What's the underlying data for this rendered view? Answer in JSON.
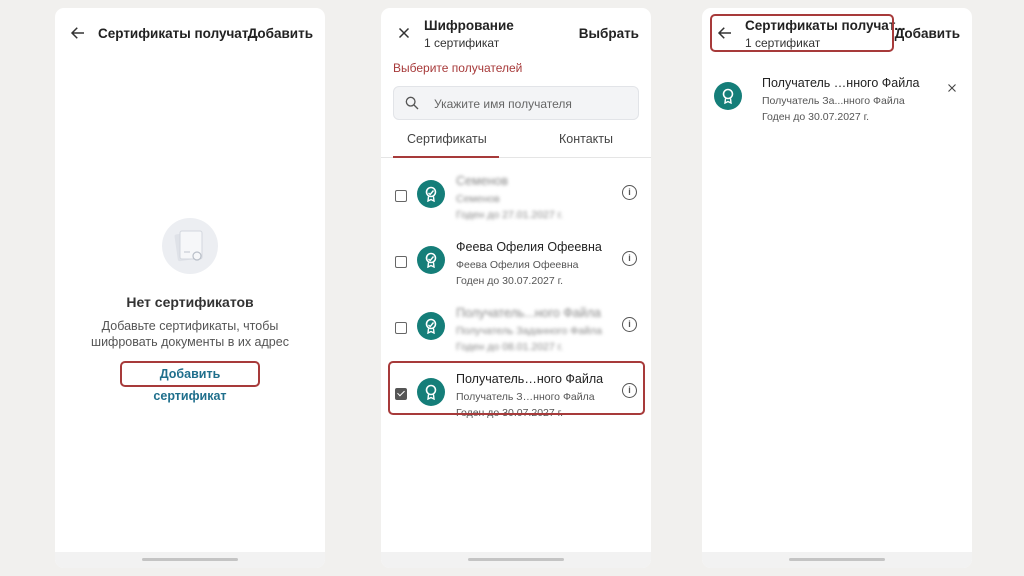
{
  "panel1": {
    "title": "Сертификаты получат...",
    "action": "Добавить",
    "empty_title": "Нет сертификатов",
    "empty_desc": "Добавьте сертификаты, чтобы шифровать документы в их адрес",
    "add_link": "Добавить сертификат"
  },
  "panel2": {
    "title": "Шифрование",
    "subtitle": "1 сертификат",
    "action": "Выбрать",
    "warning": "Выберите получателей",
    "search_placeholder": "Укажите имя получателя",
    "tabs": [
      "Сертификаты",
      "Контакты"
    ],
    "rows": [
      {
        "name": "Семенов",
        "line2": "Семенов",
        "line3": "Годен до 27.01.2027 г.",
        "checked": false
      },
      {
        "name": "Феева Офелия Офеевна",
        "line2": "Феева Офелия Офеевна",
        "line3": "Годен до 30.07.2027 г.",
        "checked": false
      },
      {
        "name": "Получатель...ного Файла",
        "line2": "Получатель Заданного Файла",
        "line3": "Годен до 08.01.2027 г.",
        "checked": false
      },
      {
        "name": "Получатель…ного Файла",
        "line2": "Получатель З…нного Файла",
        "line3": "Годен до 30.07.2027 г.",
        "checked": true
      }
    ]
  },
  "panel3": {
    "title": "Сертификаты получат...",
    "subtitle": "1 сертификат",
    "action": "Добавить",
    "item": {
      "name": "Получатель …нного Файла",
      "line2": "Получатель За...нного Файла",
      "line3": "Годен до 30.07.2027 г."
    }
  },
  "colors": {
    "accent": "#a73a3a",
    "badge": "#157e79",
    "link": "#1f6f8c"
  }
}
